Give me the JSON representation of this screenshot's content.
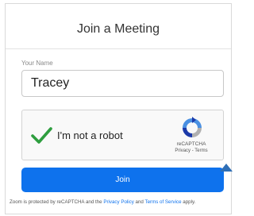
{
  "join": {
    "title": "Join a Meeting",
    "name_label": "Your Name",
    "name_value": "Tracey",
    "button_label": "Join"
  },
  "captcha": {
    "label": "I'm not a robot",
    "brand": "reCAPTCHA",
    "privacy": "Privacy",
    "separator": " - ",
    "terms": "Terms",
    "checked": true
  },
  "footer": {
    "prefix": "Zoom is protected by reCAPTCHA and the ",
    "privacy_link": "Privacy Policy",
    "middle": " and ",
    "terms_link": "Terms of Service",
    "suffix": " apply."
  },
  "colors": {
    "accent": "#0e72ed",
    "check": "#2e9e3f"
  },
  "icons": {
    "check": "check-icon",
    "recaptcha": "recaptcha-logo-icon",
    "pointer": "pointer-arrow-icon"
  }
}
